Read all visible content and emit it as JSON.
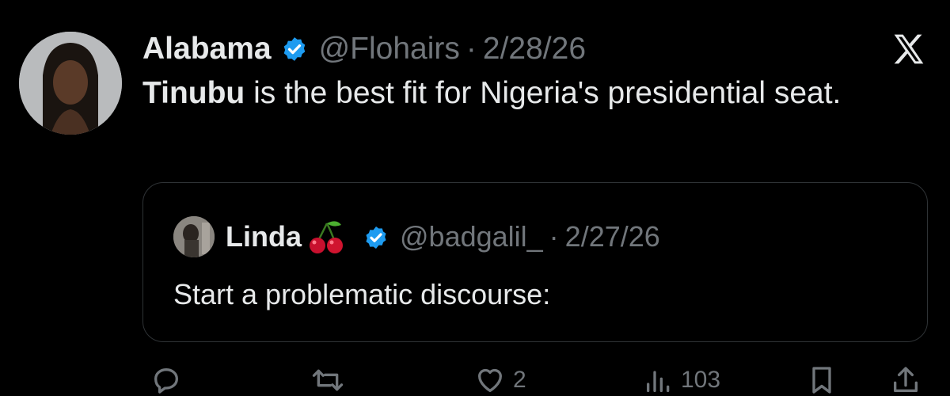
{
  "tweet": {
    "author_name": "Alabama",
    "handle": "@Flohairs",
    "separator": "·",
    "date": "2/28/26",
    "text_bold": "Tinubu",
    "text_rest": " is the best fit for Nigeria's presidential seat."
  },
  "quoted_tweet": {
    "author_name": "Linda",
    "handle": "@badgalil_",
    "separator": "·",
    "date": "2/27/26",
    "text": "Start a problematic discourse:"
  },
  "actions": {
    "likes_count": "2",
    "views_count": "103"
  },
  "icons": {
    "verified": "verified-badge-icon",
    "brand": "x-logo-icon",
    "emoji": "cherries-emoji",
    "reply": "reply-icon",
    "retweet": "retweet-icon",
    "like": "heart-icon",
    "views": "views-icon",
    "bookmark": "bookmark-icon",
    "share": "share-icon"
  },
  "colors": {
    "background": "#000000",
    "primary_text": "#e7e9ea",
    "secondary_text": "#71767b",
    "verified_blue": "#1d9bf0",
    "border": "#2f3336"
  }
}
